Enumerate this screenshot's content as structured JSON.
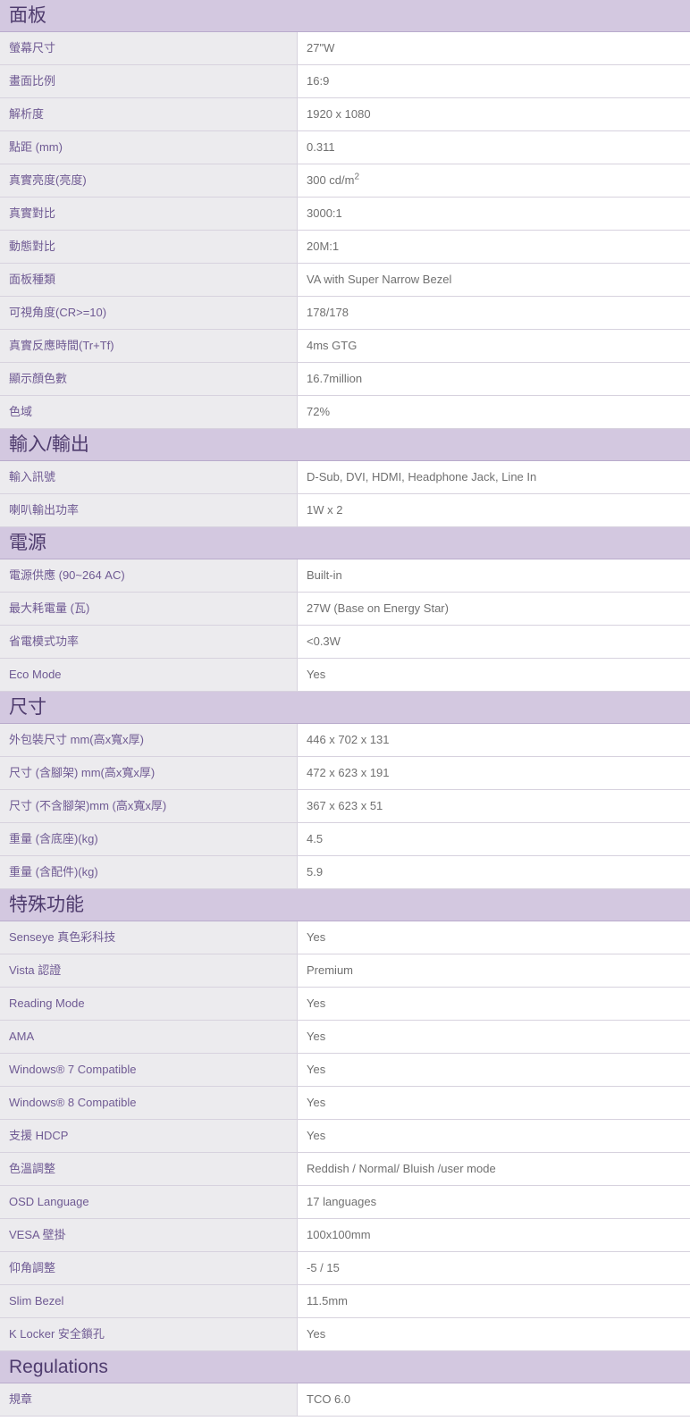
{
  "sections": [
    {
      "title": "面板",
      "rows": [
        {
          "label": "螢幕尺寸",
          "value": "27\"W"
        },
        {
          "label": "畫面比例",
          "value": "16:9"
        },
        {
          "label": "解析度",
          "value": "1920 x 1080"
        },
        {
          "label": "點距 (mm)",
          "value": "0.311"
        },
        {
          "label": "真實亮度(亮度)",
          "value": "300 cd/m",
          "sup": "2"
        },
        {
          "label": "真實對比",
          "value": "3000:1"
        },
        {
          "label": "動態對比",
          "value": "20M:1"
        },
        {
          "label": "面板種類",
          "value": "VA with Super Narrow Bezel"
        },
        {
          "label": "可視角度(CR>=10)",
          "value": "178/178"
        },
        {
          "label": "真實反應時間(Tr+Tf)",
          "value": "4ms GTG"
        },
        {
          "label": "顯示顏色數",
          "value": "16.7million"
        },
        {
          "label": "色域",
          "value": "72%"
        }
      ]
    },
    {
      "title": "輸入/輸出",
      "rows": [
        {
          "label": "輸入訊號",
          "value": "D-Sub, DVI, HDMI, Headphone Jack, Line In"
        },
        {
          "label": "喇叭輸出功率",
          "value": "1W x 2"
        }
      ]
    },
    {
      "title": "電源",
      "rows": [
        {
          "label": "電源供應 (90~264 AC)",
          "value": "Built-in"
        },
        {
          "label": "最大耗電量 (瓦)",
          "value": "27W (Base on Energy Star)"
        },
        {
          "label": "省電模式功率",
          "value": "<0.3W"
        },
        {
          "label": "Eco Mode",
          "value": "Yes"
        }
      ]
    },
    {
      "title": "尺寸",
      "rows": [
        {
          "label": "外包裝尺寸 mm(高x寬x厚)",
          "value": "446 x 702 x 131"
        },
        {
          "label": "尺寸 (含腳架) mm(高x寬x厚)",
          "value": "472 x 623 x 191"
        },
        {
          "label": "尺寸 (不含腳架)mm (高x寬x厚)",
          "value": "367 x 623 x 51"
        },
        {
          "label": "重量 (含底座)(kg)",
          "value": "4.5"
        },
        {
          "label": "重量 (含配件)(kg)",
          "value": "5.9"
        }
      ]
    },
    {
      "title": "特殊功能",
      "rows": [
        {
          "label": "Senseye 真色彩科技",
          "value": "Yes"
        },
        {
          "label": "Vista 認證",
          "value": "Premium"
        },
        {
          "label": "Reading Mode",
          "value": "Yes"
        },
        {
          "label": "AMA",
          "value": "Yes"
        },
        {
          "label": "Windows® 7 Compatible",
          "value": "Yes"
        },
        {
          "label": "Windows® 8 Compatible",
          "value": "Yes"
        },
        {
          "label": "支援 HDCP",
          "value": "Yes"
        },
        {
          "label": "色溫調整",
          "value": "Reddish / Normal/ Bluish /user mode"
        },
        {
          "label": "OSD Language",
          "value": "17 languages"
        },
        {
          "label": "VESA 壁掛",
          "value": "100x100mm"
        },
        {
          "label": "仰角調整",
          "value": "-5 / 15"
        },
        {
          "label": "Slim Bezel",
          "value": "11.5mm"
        },
        {
          "label": "K Locker 安全鎖孔",
          "value": "Yes"
        }
      ]
    },
    {
      "title": "Regulations",
      "rows": [
        {
          "label": "規章",
          "value": "TCO 6.0"
        }
      ]
    }
  ]
}
